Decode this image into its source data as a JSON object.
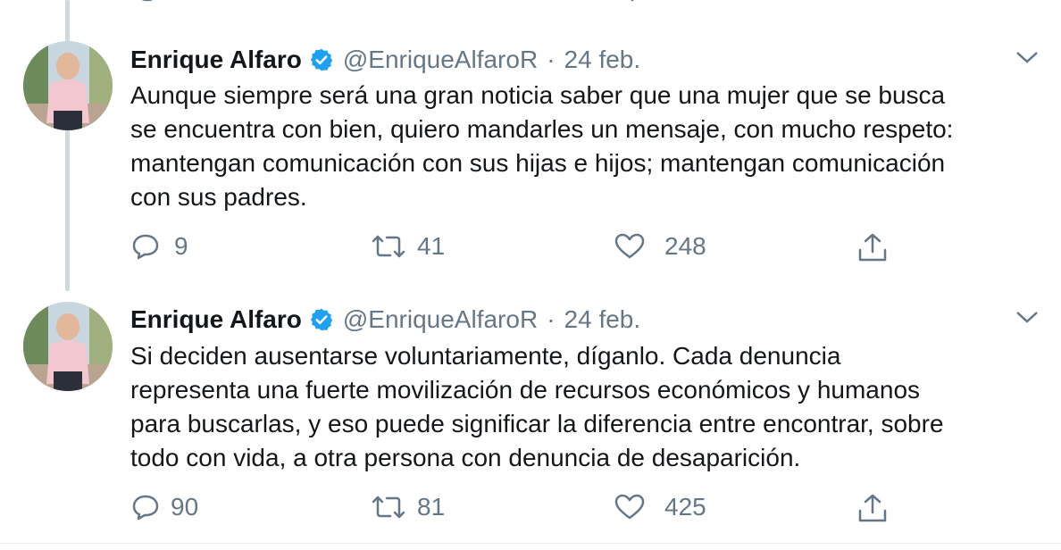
{
  "tweets": [
    {
      "author": {
        "name": "Enrique Alfaro",
        "handle": "@EnriqueAlfaroR",
        "verified": true,
        "avatar_icon": "person-photo-avatar"
      },
      "date": "24 feb.",
      "separator": "·",
      "lines": [
        "Aunque siempre será una gran noticia saber que una mujer que se busca",
        "se encuentra con bien, quiero mandarles un mensaje, con mucho respeto:",
        "mantengan comunicación con sus hijas e hijos; mantengan comunicación",
        "con sus padres."
      ],
      "stats": {
        "replies": "9",
        "retweets": "41",
        "likes": "248"
      }
    },
    {
      "author": {
        "name": "Enrique Alfaro",
        "handle": "@EnriqueAlfaroR",
        "verified": true,
        "avatar_icon": "person-photo-avatar"
      },
      "date": "24 feb.",
      "separator": "·",
      "lines": [
        "Si deciden ausentarse voluntariamente, díganlo. Cada denuncia",
        "representa una fuerte movilización de recursos económicos y humanos",
        "para buscarlas, y eso puede significar la diferencia entre encontrar, sobre",
        "todo con vida, a otra persona con denuncia de desaparición."
      ],
      "stats": {
        "replies": "90",
        "retweets": "81",
        "likes": "425"
      }
    }
  ],
  "colors": {
    "text": "#14171a",
    "secondary": "#657786",
    "verified": "#1da1f2",
    "thread_line": "#cfd9de"
  }
}
